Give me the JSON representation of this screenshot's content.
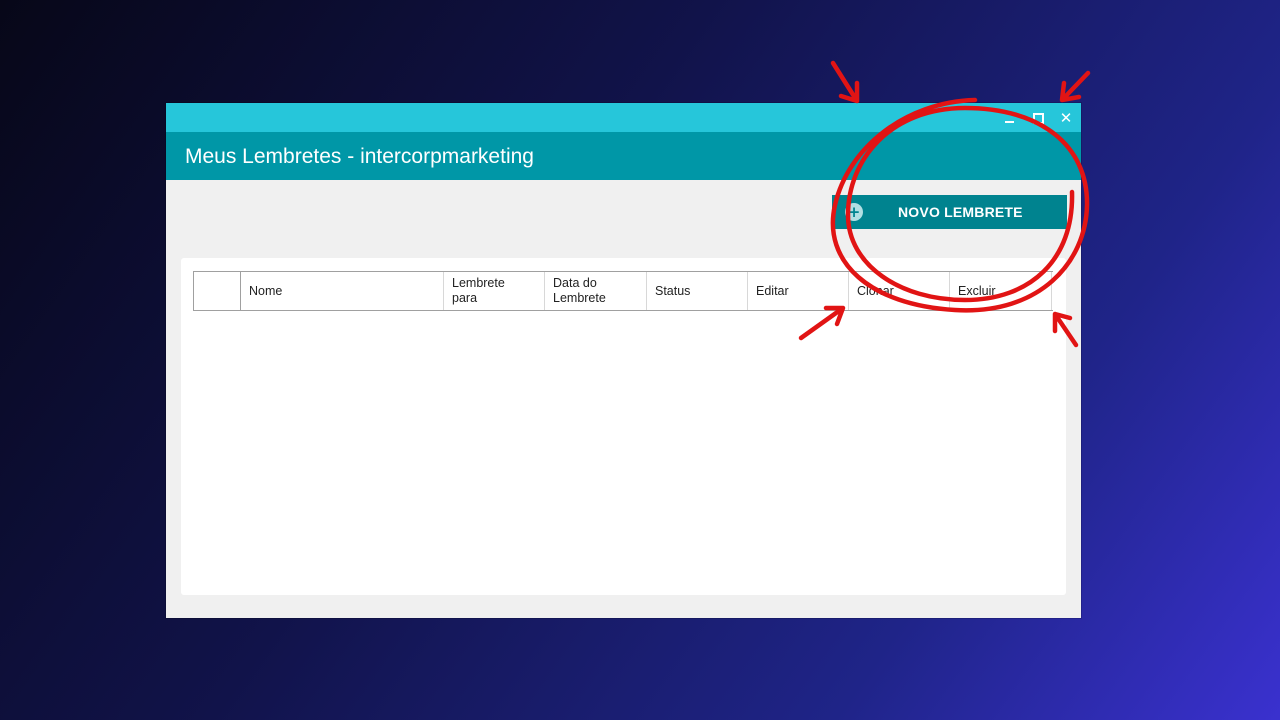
{
  "window": {
    "title": "Meus Lembretes - intercorpmarketing",
    "controls": {
      "minimize_icon": "minimize-icon",
      "maximize_icon": "maximize-icon",
      "close_icon": "close-icon",
      "close_glyph": "✕"
    }
  },
  "toolbar": {
    "new_button_label": "NOVO LEMBRETE",
    "new_button_icon": "plus-circle-icon",
    "new_button_glyph": "+"
  },
  "table": {
    "columns": [
      "",
      "Nome",
      "Lembrete\npara",
      "Data do\nLembrete",
      "Status",
      "Editar",
      "Clonar",
      "Excluir"
    ],
    "rows": []
  },
  "colors": {
    "titlebar": "#26c6da",
    "header": "#0097a7",
    "button": "#00838f",
    "annotation": "#e11414",
    "background_start": "#070718",
    "background_end": "#3a31cf"
  }
}
